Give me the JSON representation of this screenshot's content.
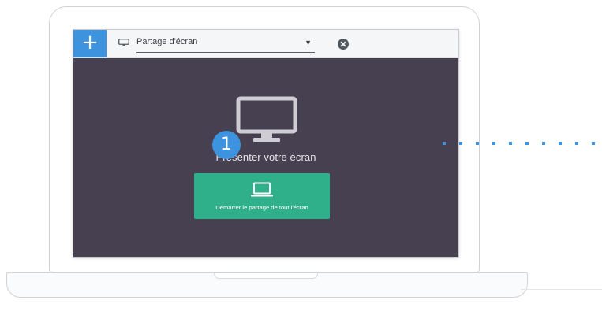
{
  "toolbar": {
    "add_symbol": "+",
    "dropdown_selected": "Partage d'écran",
    "caret": "▼"
  },
  "content": {
    "present_title": "Présenter votre écran",
    "start_button_label": "Démarrer le partage de tout l'écran",
    "step_badge": "1"
  },
  "icons": {
    "add": "plus-icon",
    "screen_share": "monitor-icon",
    "dropdown": "chevron-down-icon",
    "close": "close-icon",
    "present": "monitor-icon",
    "start": "laptop-icon"
  },
  "colors": {
    "accent_blue": "#3e93de",
    "screen_background": "#464050",
    "start_button": "#2fb08a",
    "toolbar": "#f5f6f7"
  }
}
